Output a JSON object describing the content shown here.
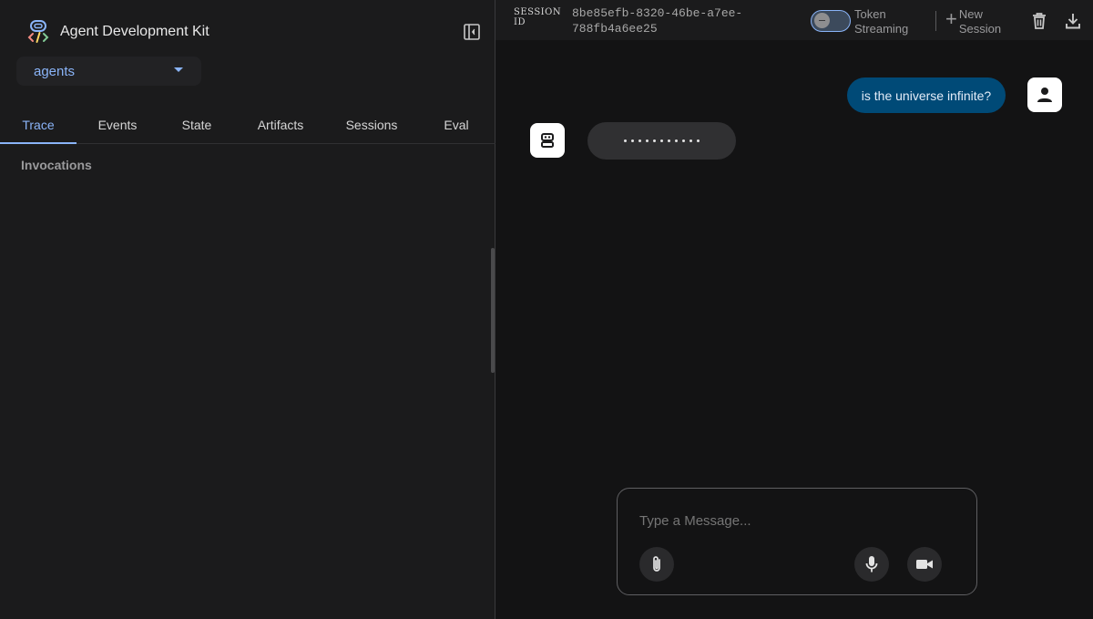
{
  "sidebar": {
    "app_title": "Agent Development Kit",
    "agent_select": {
      "value": "agents"
    },
    "tabs": [
      {
        "label": "Trace",
        "active": true
      },
      {
        "label": "Events",
        "active": false
      },
      {
        "label": "State",
        "active": false
      },
      {
        "label": "Artifacts",
        "active": false
      },
      {
        "label": "Sessions",
        "active": false
      },
      {
        "label": "Eval",
        "active": false
      }
    ],
    "section_title": "Invocations"
  },
  "header": {
    "session_label": "SESSION ID",
    "session_id": "8be85efb-8320-46be-a7ee-788fb4a6ee25",
    "streaming_toggle": {
      "label": "Token Streaming",
      "enabled": false
    },
    "new_session_label": "New Session",
    "icons": [
      "delete-icon",
      "download-icon"
    ]
  },
  "chat": {
    "messages": [
      {
        "role": "user",
        "text": "is the universe infinite?"
      },
      {
        "role": "bot",
        "text": "",
        "status": "typing"
      }
    ]
  },
  "composer": {
    "placeholder": "Type a Message...",
    "buttons": [
      "attach-icon",
      "mic-icon",
      "videocam-icon"
    ]
  },
  "colors": {
    "accent": "#8ab4f8",
    "user_bubble": "#004a77",
    "bot_bubble": "#303032",
    "background": "#131314",
    "panel": "#1b1b1c"
  }
}
